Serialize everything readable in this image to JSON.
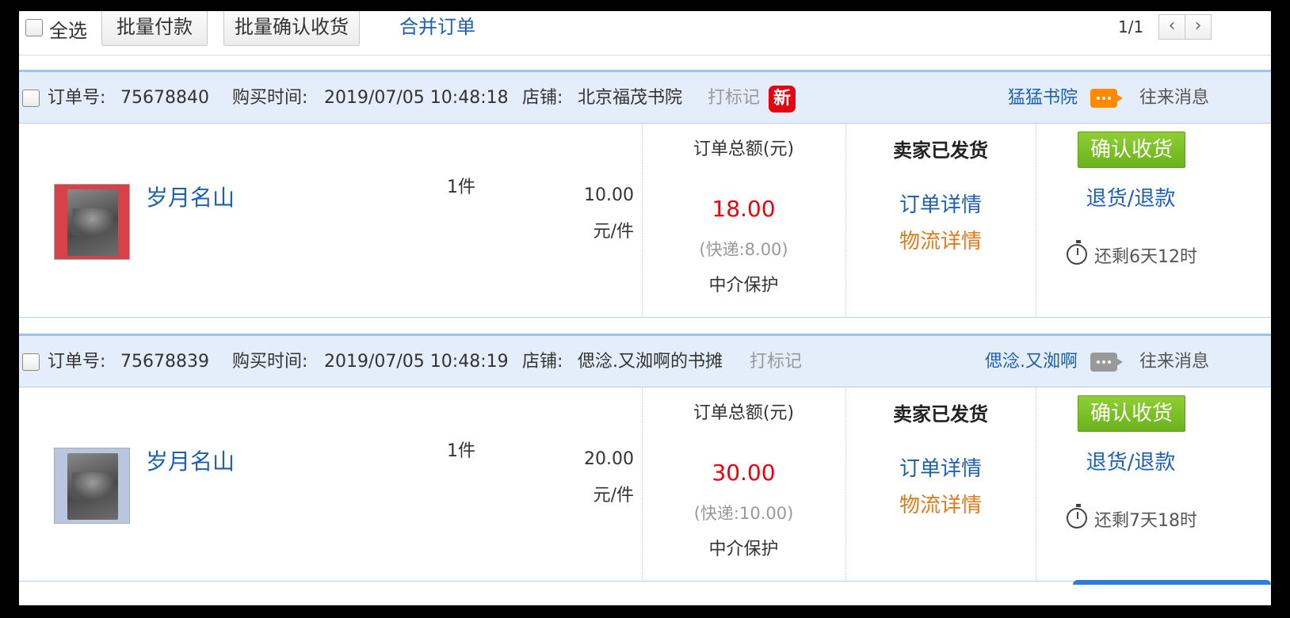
{
  "toolbar": {
    "select_all_label": "全选",
    "batch_pay_label": "批量付款",
    "batch_confirm_label": "批量确认收货",
    "merge_orders_label": "合并订单",
    "page_indicator": "1/1",
    "prev_icon": "chevron-left-icon",
    "next_icon": "chevron-right-icon"
  },
  "orders": [
    {
      "order_no_label": "订单号:",
      "order_no": "75678840",
      "time_label": "购买时间:",
      "time": "2019/07/05 10:48:18",
      "shop_label": "店铺:",
      "shop": "北京福茂书院",
      "mark_label": "打标记",
      "new_badge": "新",
      "seller_name": "猛猛书院",
      "chat_icon_color": "#ff8a00",
      "messages_label": "往来消息",
      "item_title": "岁月名山",
      "quantity": "1件",
      "unit_price": "10.00",
      "unit_suffix": "元/件",
      "total_label": "订单总额(元)",
      "total": "18.00",
      "shipping": "(快递:8.00)",
      "protection": "中介保护",
      "status": "卖家已发货",
      "detail_link": "订单详情",
      "logistics_link": "物流详情",
      "confirm_button": "确认收货",
      "refund_link": "退货/退款",
      "time_remaining": "还剩6天12时"
    },
    {
      "order_no_label": "订单号:",
      "order_no": "75678839",
      "time_label": "购买时间:",
      "time": "2019/07/05 10:48:19",
      "shop_label": "店铺:",
      "shop": "偲淰.又洳啊的书摊",
      "mark_label": "打标记",
      "seller_name": "偲淰.又洳啊",
      "chat_icon_color": "#999999",
      "messages_label": "往来消息",
      "item_title": "岁月名山",
      "quantity": "1件",
      "unit_price": "20.00",
      "unit_suffix": "元/件",
      "total_label": "订单总额(元)",
      "total": "30.00",
      "shipping": "(快递:10.00)",
      "protection": "中介保护",
      "status": "卖家已发货",
      "detail_link": "订单详情",
      "logistics_link": "物流详情",
      "confirm_button": "确认收货",
      "refund_link": "退货/退款",
      "time_remaining": "还剩7天18时"
    }
  ],
  "colors": {
    "link_blue": "#1f5fb0",
    "total_red": "#e60012",
    "logistics_orange": "#e07a1c",
    "confirm_green": "#7cc128",
    "header_bg": "#e4eefa"
  }
}
